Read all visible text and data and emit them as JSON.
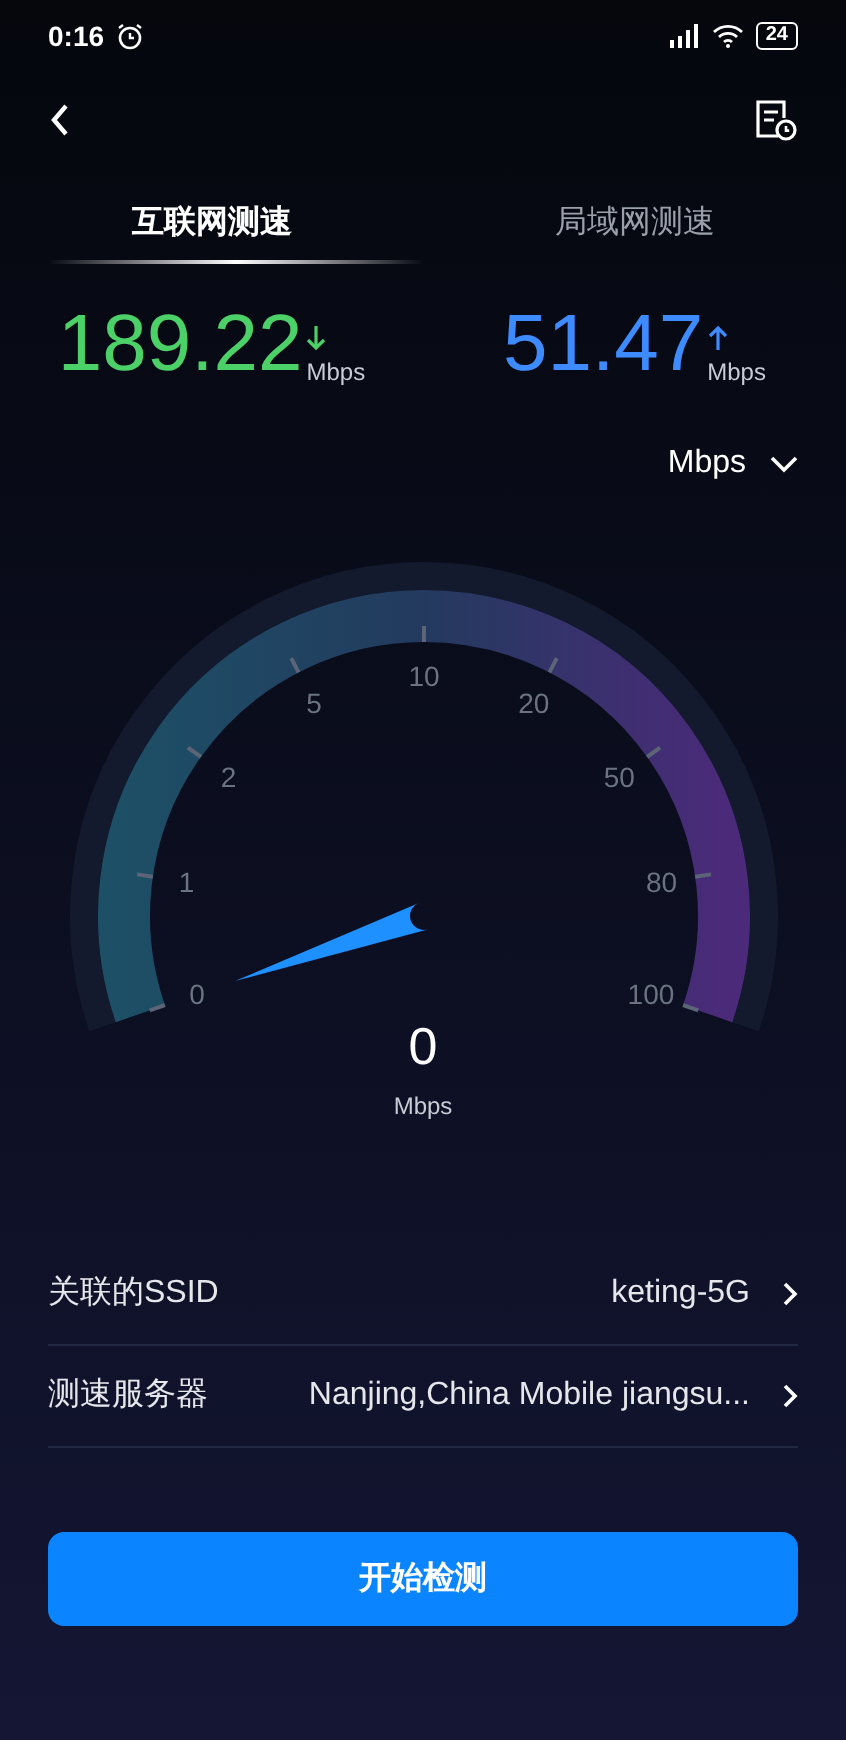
{
  "status_bar": {
    "time": "0:16",
    "battery": "24"
  },
  "tabs": [
    {
      "label": "互联网测速",
      "selected": true
    },
    {
      "label": "局域网测速",
      "selected": false
    }
  ],
  "results": [
    {
      "kind": "download",
      "value": "189.22",
      "unit": "Mbps"
    },
    {
      "kind": "upload",
      "value": "51.47",
      "unit": "Mbps"
    }
  ],
  "unit_selector": "Mbps",
  "gauge": {
    "ticks": [
      "0",
      "1",
      "2",
      "5",
      "10",
      "20",
      "50",
      "80",
      "100"
    ],
    "reading": "0",
    "unit": "Mbps"
  },
  "settings": [
    {
      "label": "关联的SSID",
      "value": "keting-5G"
    },
    {
      "label": "测速服务器",
      "value": "Nanjing,China Mobile jiangsu..."
    }
  ],
  "start_button": "开始检测"
}
